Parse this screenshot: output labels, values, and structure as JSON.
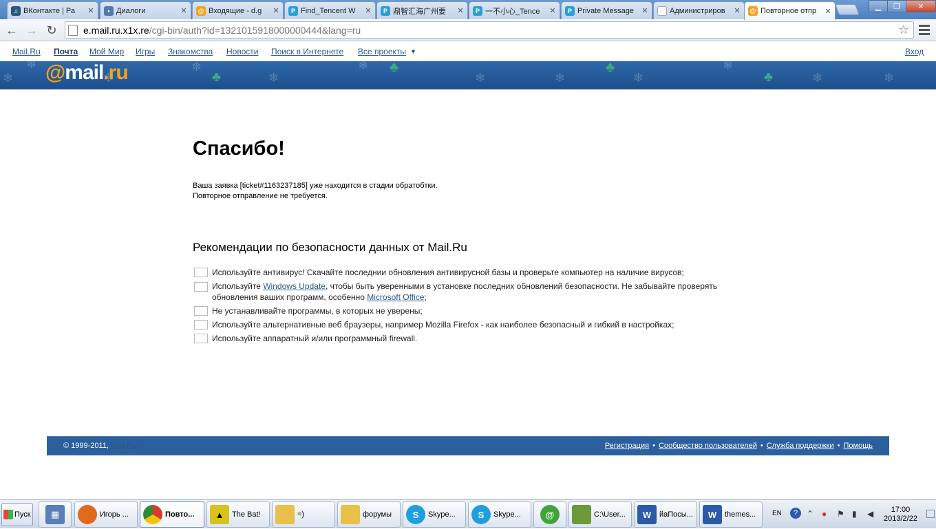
{
  "browser": {
    "tabs": [
      {
        "title": "ВКонтакте | Ра",
        "icon": "music-note-icon",
        "color": "#2b587a"
      },
      {
        "title": "Диалоги",
        "icon": "chat-icon",
        "color": "#4f7ab0"
      },
      {
        "title": "Входящие - d.g",
        "icon": "mail-at-icon",
        "color": "#f7a21b"
      },
      {
        "title": "Find_Tencent W",
        "icon": "p-icon",
        "color": "#2aa0d8"
      },
      {
        "title": "鼎智汇海广州要",
        "icon": "p-icon",
        "color": "#2aa0d8"
      },
      {
        "title": "一不小心_Tence",
        "icon": "p-icon",
        "color": "#2aa0d8"
      },
      {
        "title": "Private Message",
        "icon": "p-icon",
        "color": "#2aa0d8"
      },
      {
        "title": "Администриров",
        "icon": "page-icon",
        "color": "#9aa8bb"
      },
      {
        "title": "Повторное отпр",
        "icon": "mail-at-icon",
        "color": "#f7a21b",
        "active": true
      }
    ],
    "url_domain": "e.mail.ru.x1x.re",
    "url_path": "/cgi-bin/auth?id=1321015918000000444&lang=ru"
  },
  "portal_nav": {
    "items": [
      "Mail.Ru",
      "Почта",
      "Мой Мир",
      "Игры",
      "Знакомства",
      "Новости",
      "Поиск в Интернете",
      "Все проекты"
    ],
    "login": "Вход"
  },
  "logo": {
    "at": "@",
    "mail": "mail",
    "dot": ".",
    "ru": "ru"
  },
  "main": {
    "title": "Спасибо!",
    "message_line1": "Ваша заявка [ticket#1163237185] уже находится в стадии обратобтки.",
    "message_line2": "Повторное отправление не требуется.",
    "rec_title": "Рекомендации по безопасности данных от Mail.Ru",
    "rec1": "Используйте антивирус! Скачайте последнии обновления антивирусной базы и проверьте компьютер на наличие вирусов;",
    "rec2_pre": "Используйте ",
    "rec2_link1": "Windows Update",
    "rec2_mid": ", чтобы быть уверенными в установке последних обновлений безопасности. Не забывайте проверять обновления ваших программ, особенно ",
    "rec2_link2": "Microsoft Office",
    "rec2_post": ";",
    "rec3": "Не устанавливайте программы, в которых не уверены;",
    "rec4": "Используйте альтернативные веб браузеры, например Mozilla Firefox - как наиболее безопасный и гибкий в настройках;",
    "rec5": "Используйте аппаратный и/или программный firewall."
  },
  "footer": {
    "copyright": "© 1999-2011,",
    "copyright_link": "Mail.Ru",
    "links": [
      "Регистрация",
      "Сообщество пользователей",
      "Служба поддержки",
      "Помощь"
    ],
    "separator": "•"
  },
  "taskbar": {
    "start": "Пуск",
    "items": [
      {
        "label": "",
        "icon": "calculator-icon",
        "color": "#5a7fb6"
      },
      {
        "label": "Игорь ...",
        "icon": "firefox-icon",
        "color": "#e06a1b"
      },
      {
        "label": "Повто...",
        "icon": "chrome-icon",
        "color": "#2e8b3a",
        "active": true
      },
      {
        "label": "The Bat!",
        "icon": "bat-icon",
        "color": "#d9c21a"
      },
      {
        "label": "=)",
        "icon": "folder-icon",
        "color": "#e8c04a"
      },
      {
        "label": "форумы",
        "icon": "folder-icon",
        "color": "#e8c04a"
      },
      {
        "label": "Skype...",
        "icon": "skype-icon",
        "color": "#1e9fe0"
      },
      {
        "label": "Skype...",
        "icon": "skype-icon",
        "color": "#1e9fe0"
      },
      {
        "label": "",
        "icon": "mail-agent-icon",
        "color": "#3fa53b"
      },
      {
        "label": "C:\\User...",
        "icon": "notepad-icon",
        "color": "#6a9a3a"
      },
      {
        "label": "йаПосы...",
        "icon": "word-icon",
        "color": "#2a5ba8"
      },
      {
        "label": "themes...",
        "icon": "word-icon",
        "color": "#2a5ba8"
      }
    ],
    "lang": "EN",
    "help": "?",
    "time": "17:00",
    "date": "2013/2/22"
  }
}
